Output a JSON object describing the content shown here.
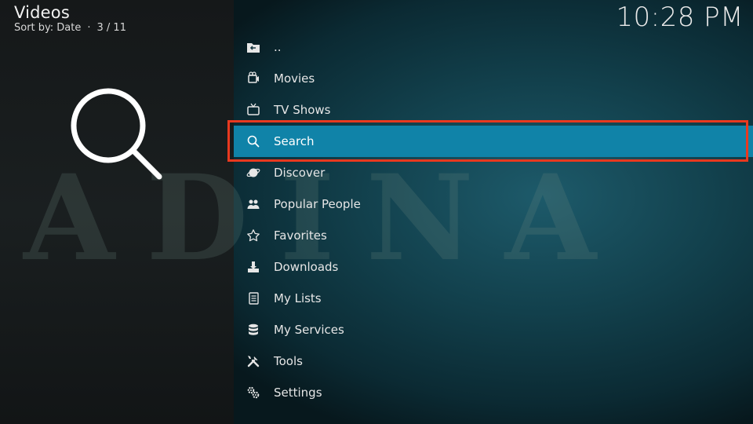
{
  "header": {
    "title": "Videos",
    "sort_label": "Sort by: Date",
    "position": "3 / 11",
    "clock": "10:28 PM"
  },
  "background": {
    "watermark_text": "ADINA"
  },
  "menu": {
    "items": [
      {
        "label": "..",
        "icon": "folder-back-icon"
      },
      {
        "label": "Movies",
        "icon": "film-reel-icon"
      },
      {
        "label": "TV Shows",
        "icon": "tv-icon"
      },
      {
        "label": "Search",
        "icon": "search-icon",
        "focused": true
      },
      {
        "label": "Discover",
        "icon": "planet-icon"
      },
      {
        "label": "Popular People",
        "icon": "people-icon"
      },
      {
        "label": "Favorites",
        "icon": "star-icon"
      },
      {
        "label": "Downloads",
        "icon": "downloads-icon"
      },
      {
        "label": "My Lists",
        "icon": "list-icon"
      },
      {
        "label": "My Services",
        "icon": "database-icon"
      },
      {
        "label": "Tools",
        "icon": "tools-icon"
      },
      {
        "label": "Settings",
        "icon": "gears-icon"
      }
    ]
  },
  "colors": {
    "focus": "#1083a8",
    "highlight_border": "#e8391f",
    "background_teal": "#1d5a6a"
  }
}
